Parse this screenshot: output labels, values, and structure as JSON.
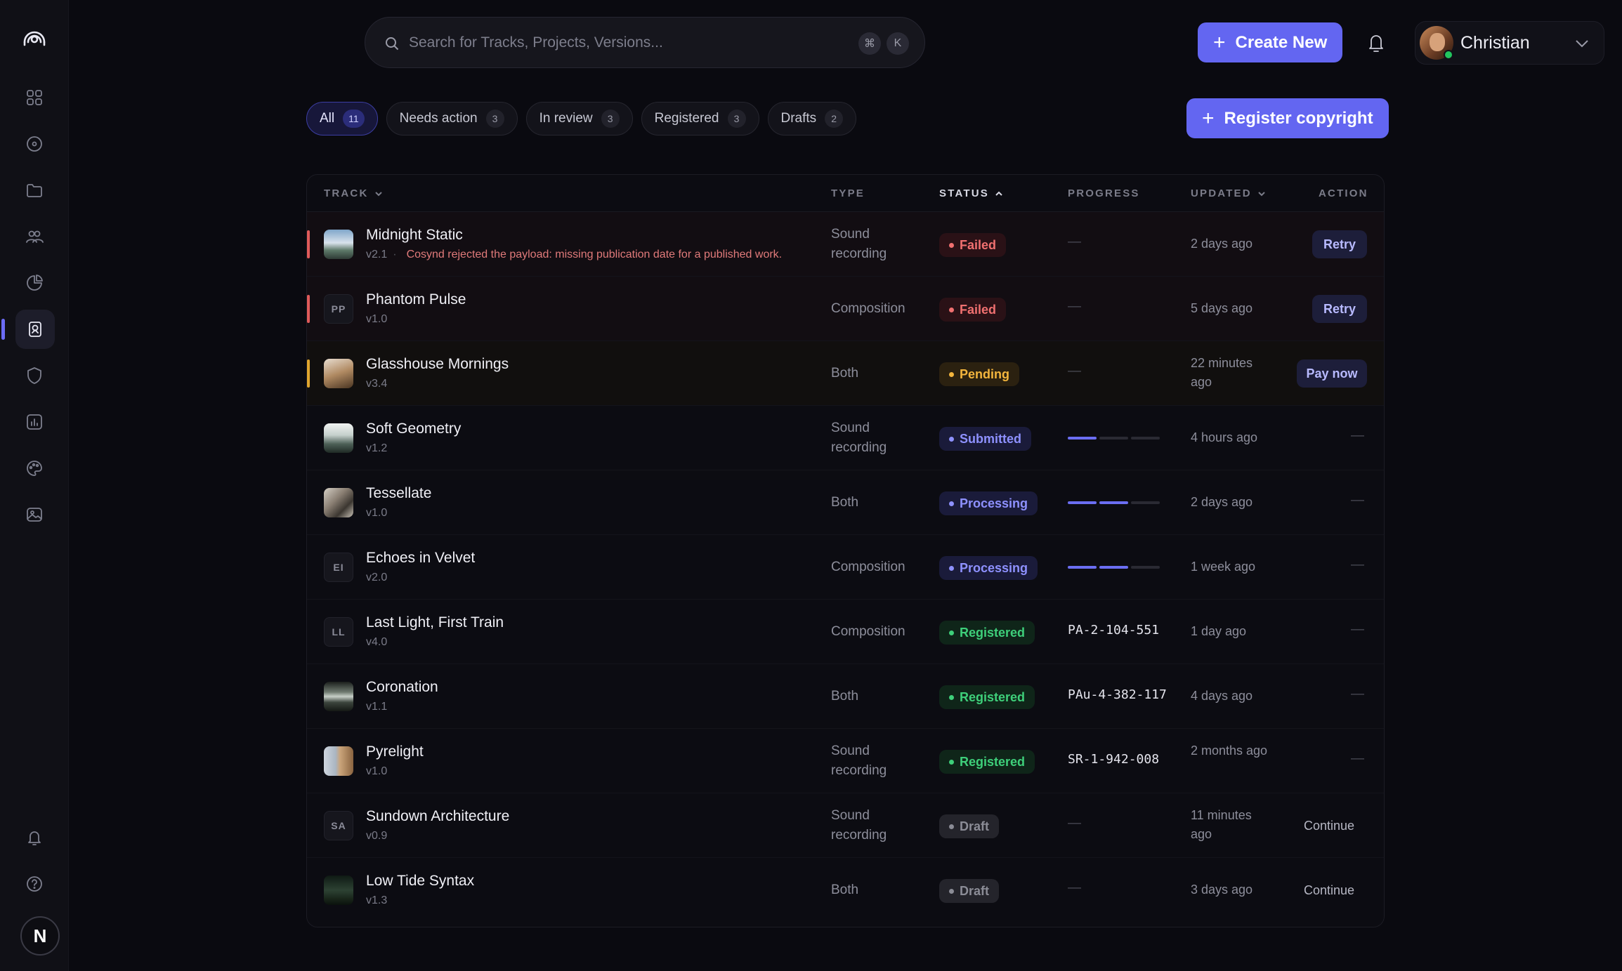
{
  "search": {
    "placeholder": "Search for Tracks, Projects, Versions...",
    "kbd1": "⌘",
    "kbd2": "K"
  },
  "header": {
    "create_label": "Create New",
    "register_label": "Register copyright",
    "user_name": "Christian"
  },
  "sidebar": {
    "avatar_letter": "N"
  },
  "filters": [
    {
      "label": "All",
      "count": "11"
    },
    {
      "label": "Needs action",
      "count": "3"
    },
    {
      "label": "In review",
      "count": "3"
    },
    {
      "label": "Registered",
      "count": "3"
    },
    {
      "label": "Drafts",
      "count": "2"
    }
  ],
  "columns": {
    "track": "TRACK",
    "type": "TYPE",
    "status": "STATUS",
    "progress": "PROGRESS",
    "updated": "UPDATED",
    "action": "ACTION"
  },
  "colors": {
    "accent": "#6366f1",
    "failed": "#f07070",
    "pending": "#f3b53d",
    "registered": "#3ecf7a"
  },
  "rows": [
    {
      "title": "Midnight Static",
      "version": "v2.1",
      "error": "Cosynd rejected the payload: missing publication date for a published work.",
      "type": "Sound recording",
      "status": "Failed",
      "progress": "—",
      "updated": "2 days ago",
      "action": "Retry"
    },
    {
      "title": "Phantom Pulse",
      "initials": "PP",
      "version": "v1.0",
      "type": "Composition",
      "status": "Failed",
      "progress": "—",
      "updated": "5 days ago",
      "action": "Retry"
    },
    {
      "title": "Glasshouse Mornings",
      "version": "v3.4",
      "type": "Both",
      "status": "Pending",
      "progress": "—",
      "updated": "22 minutes ago",
      "action": "Pay now"
    },
    {
      "title": "Soft Geometry",
      "version": "v1.2",
      "type": "Sound recording",
      "status": "Submitted",
      "progress_steps": 1,
      "updated": "4 hours ago",
      "action": "—"
    },
    {
      "title": "Tessellate",
      "version": "v1.0",
      "type": "Both",
      "status": "Processing",
      "progress_steps": 2,
      "updated": "2 days ago",
      "action": "—"
    },
    {
      "title": "Echoes in Velvet",
      "initials": "EI",
      "version": "v2.0",
      "type": "Composition",
      "status": "Processing",
      "progress_steps": 2,
      "updated": "1 week ago",
      "action": "—"
    },
    {
      "title": "Last Light, First Train",
      "initials": "LL",
      "version": "v4.0",
      "type": "Composition",
      "status": "Registered",
      "progress": "PA-2-104-551",
      "updated": "1 day ago",
      "action": "—"
    },
    {
      "title": "Coronation",
      "version": "v1.1",
      "type": "Both",
      "status": "Registered",
      "progress": "PAu-4-382-117",
      "updated": "4 days ago",
      "action": "—"
    },
    {
      "title": "Pyrelight",
      "version": "v1.0",
      "type": "Sound recording",
      "status": "Registered",
      "progress": "SR-1-942-008",
      "updated": "2 months ago",
      "action": "—"
    },
    {
      "title": "Sundown Architecture",
      "initials": "SA",
      "version": "v0.9",
      "type": "Sound recording",
      "status": "Draft",
      "progress": "—",
      "updated": "11 minutes ago",
      "action": "Continue"
    },
    {
      "title": "Low Tide Syntax",
      "version": "v1.3",
      "type": "Both",
      "status": "Draft",
      "progress": "—",
      "updated": "3 days ago",
      "action": "Continue"
    }
  ]
}
